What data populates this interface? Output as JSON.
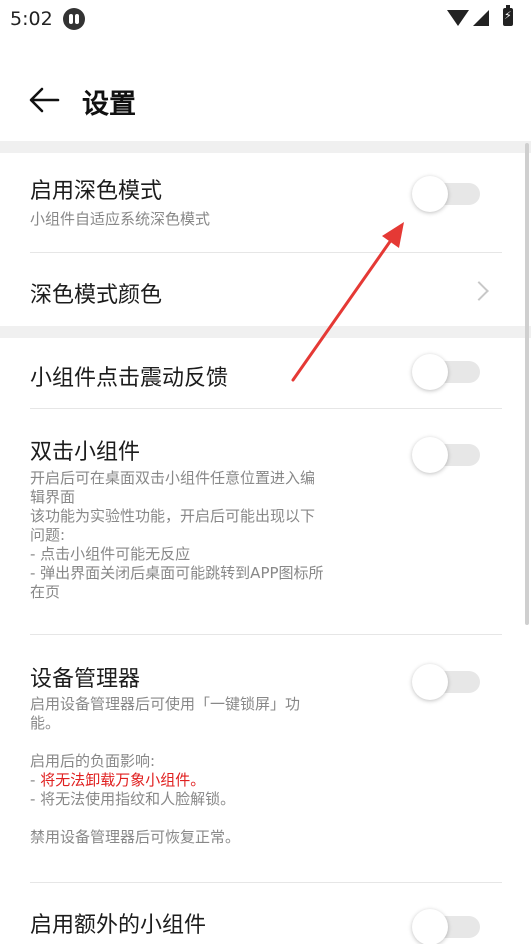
{
  "status_bar": {
    "time": "5:02"
  },
  "header": {
    "title": "设置"
  },
  "settings": {
    "dark_mode": {
      "title": "启用深色模式",
      "desc": "小组件自适应系统深色模式",
      "enabled": false
    },
    "dark_mode_color": {
      "title": "深色模式颜色"
    },
    "click_vibration": {
      "title": "小组件点击震动反馈",
      "enabled": false
    },
    "double_tap": {
      "title": "双击小组件",
      "desc_lines": [
        "开启后可在桌面双击小组件任意位置进入编",
        "辑界面",
        "该功能为实验性功能，开启后可能出现以下",
        "问题:",
        "- 点击小组件可能无反应",
        "- 弹出界面关闭后桌面可能跳转到APP图标所",
        "在页"
      ],
      "enabled": false
    },
    "device_admin": {
      "title": "设备管理器",
      "desc_lines": [
        " 启用设备管理器后可使用「一键锁屏」功",
        "能。",
        "",
        "启用后的负面影响:",
        "- ",
        "- 将无法使用指纹和人脸解锁。",
        "",
        "禁用设备管理器后可恢复正常。"
      ],
      "warning_red": "将无法卸载万象小组件",
      "warning_suffix": "。",
      "enabled": false
    },
    "extra_widgets": {
      "title": "启用额外的小组件",
      "enabled": false
    }
  },
  "colors": {
    "accent_red": "#e02020",
    "annotation_arrow": "#e53935"
  }
}
